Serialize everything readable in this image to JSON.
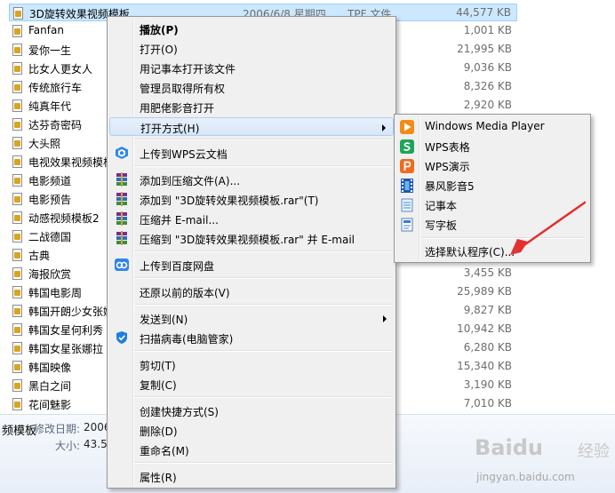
{
  "files": [
    {
      "name": "3D旋转效果视频模板",
      "date": "2006/6/8 星期四 ...",
      "type": "TPF 文件",
      "size": "44,577 KB"
    },
    {
      "name": "Fanfan",
      "size": "1,001 KB"
    },
    {
      "name": "爱你一生",
      "size": "21,995 KB"
    },
    {
      "name": "比女人更女人",
      "size": "9,036 KB"
    },
    {
      "name": "传统旅行车",
      "size": "8,326 KB"
    },
    {
      "name": "纯真年代",
      "size": "2,920 KB"
    },
    {
      "name": "达芬奇密码",
      "size": ""
    },
    {
      "name": "大头照",
      "size": ""
    },
    {
      "name": "电视效果视频模板",
      "size": ""
    },
    {
      "name": "电影频道",
      "size": ""
    },
    {
      "name": "电影预告",
      "size": ""
    },
    {
      "name": "动感视频模板2",
      "size": ""
    },
    {
      "name": "二战德国",
      "size": ""
    },
    {
      "name": "古典",
      "size": ""
    },
    {
      "name": "海报欣赏",
      "size": "3,455 KB"
    },
    {
      "name": "韩国电影周",
      "size": "25,989 KB"
    },
    {
      "name": "韩国开朗少女张娜拉",
      "size": "9,827 KB"
    },
    {
      "name": "韩国女星何利秀",
      "size": "10,942 KB"
    },
    {
      "name": "韩国女星张娜拉",
      "size": "6,280 KB"
    },
    {
      "name": "韩国映像",
      "size": "15,340 KB"
    },
    {
      "name": "黑白之间",
      "size": "3,190 KB"
    },
    {
      "name": "花间魅影",
      "size": "7,010 KB"
    }
  ],
  "details": {
    "name": "频模板",
    "modified_label": "修改日期:",
    "modified_value": "2006",
    "size_label": "大小:",
    "size_value": "43.5"
  },
  "context_menu": {
    "play": "播放(P)",
    "open": "打开(O)",
    "open_notepad": "用记事本打开该文件",
    "take_ownership": "管理员取得所有权",
    "open_feipi": "用肥佬影音打开",
    "open_with": "打开方式(H)",
    "upload_wps": "上传到WPS云文档",
    "add_archive": "添加到压缩文件(A)...",
    "add_rar": "添加到 \"3D旋转效果视频模板.rar\"(T)",
    "compress_email": "压缩并 E-mail...",
    "compress_rar_email": "压缩到 \"3D旋转效果视频模板.rar\" 并 E-mail",
    "upload_baidu": "上传到百度网盘",
    "restore_versions": "还原以前的版本(V)",
    "send_to": "发送到(N)",
    "scan_virus": "扫描病毒(电脑管家)",
    "cut": "剪切(T)",
    "copy": "复制(C)",
    "create_shortcut": "创建快捷方式(S)",
    "delete": "删除(D)",
    "rename": "重命名(M)",
    "properties": "属性(R)"
  },
  "open_with_menu": {
    "wmp": "Windows Media Player",
    "wps_sheet": "WPS表格",
    "wps_present": "WPS演示",
    "baofeng": "暴风影音5",
    "notepad": "记事本",
    "wordpad": "写字板",
    "choose_default": "选择默认程序(C)..."
  },
  "watermark": {
    "brand": "Baidu",
    "sub": "经验",
    "url": "jingyan.baidu.com"
  },
  "colors": {
    "selection": "#cce8ff",
    "menu_bg": "#f0f0f0",
    "hover": "#d7e6f8",
    "annotation_arrow": "#e03030"
  }
}
